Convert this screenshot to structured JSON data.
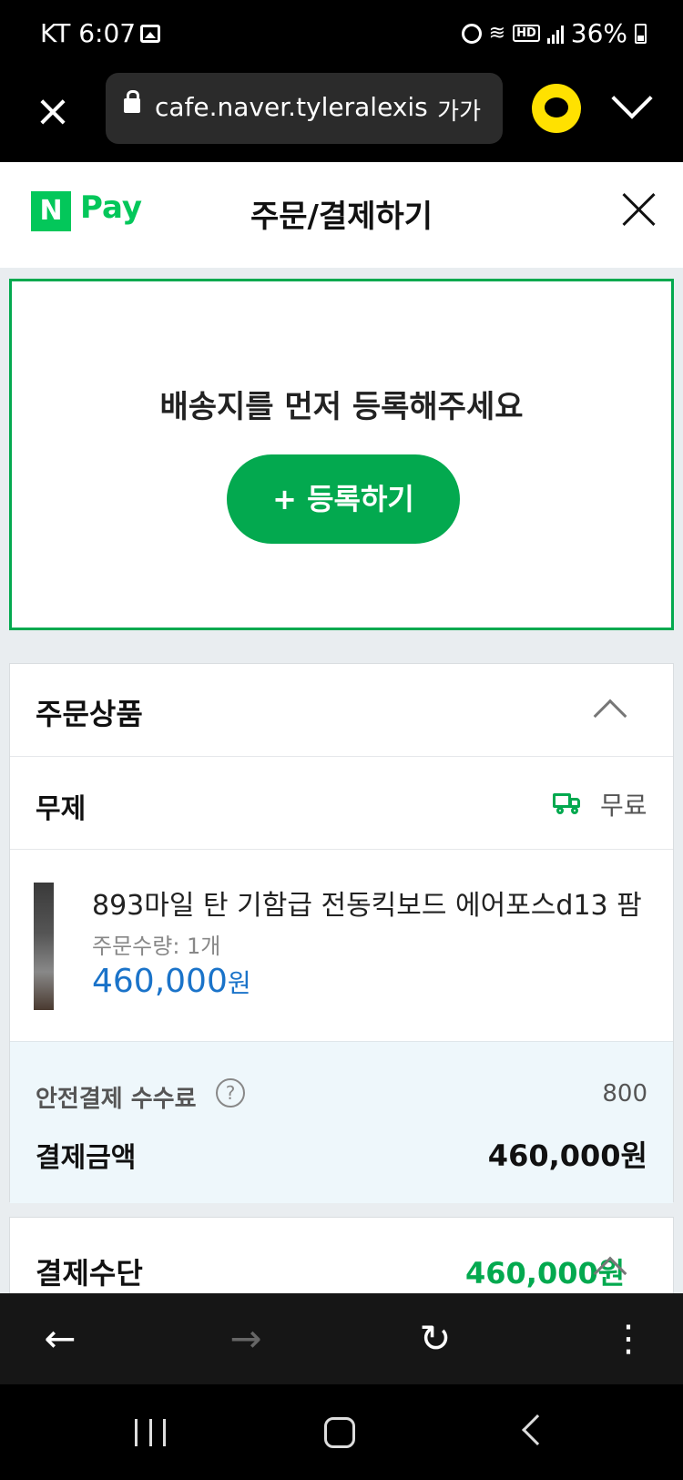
{
  "status_bar": {
    "carrier": "KT",
    "time": "6:07",
    "battery": "36%",
    "icons": [
      "gallery-icon",
      "alarm-icon",
      "wifi-icon",
      "hd-icon",
      "signal-icon",
      "battery-icon"
    ]
  },
  "browser": {
    "url": "cafe.naver.tyleralexis",
    "font_size_label": "가가",
    "icons": [
      "close-icon",
      "lock-icon",
      "chat-icon",
      "chevron-down-icon"
    ]
  },
  "header": {
    "logo_badge": "N",
    "logo_text": "Pay",
    "title": "주문/결제하기"
  },
  "address": {
    "message": "배송지를 먼저 등록해주세요",
    "register_label": "+ 등록하기"
  },
  "order": {
    "section_title": "주문상품",
    "seller": "무제",
    "shipping_fee": "무료",
    "product": {
      "name": "893마일 탄 기함급 전동킥보드 에어포스d13 팜",
      "quantity": "주문수량: 1개",
      "price": "460,000",
      "price_unit": "원"
    },
    "fee_label": "안전결제 수수료",
    "fee_value": "800",
    "total_label": "결제금액",
    "total_value": "460,000원"
  },
  "payment": {
    "title": "결제수단",
    "amount": "460,000원"
  },
  "colors": {
    "naver_green": "#03c75a",
    "button_green": "#03a94f",
    "price_blue": "#1a73c9",
    "summary_bg": "#eef7fb",
    "page_bg": "#e9edf0"
  }
}
